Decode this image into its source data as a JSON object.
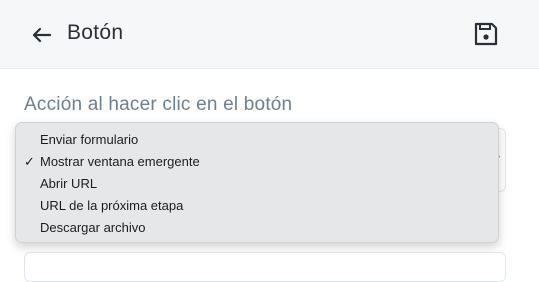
{
  "header": {
    "back_icon": "arrow-left-icon",
    "title": "Botón",
    "save_icon": "floppy-disk-icon"
  },
  "section": {
    "label": "Acción al hacer clic en el botón"
  },
  "dropdown": {
    "selected": "Mostrar ventana emergente",
    "options": [
      "Enviar formulario",
      "Mostrar ventana emergente",
      "Abrir URL",
      "URL de la próxima etapa",
      "Descargar archivo"
    ],
    "check_mark": "✓"
  },
  "colors": {
    "header_bg": "#f6f7f9",
    "label": "#6f7f92",
    "menu_bg": "#e6e7e9"
  }
}
